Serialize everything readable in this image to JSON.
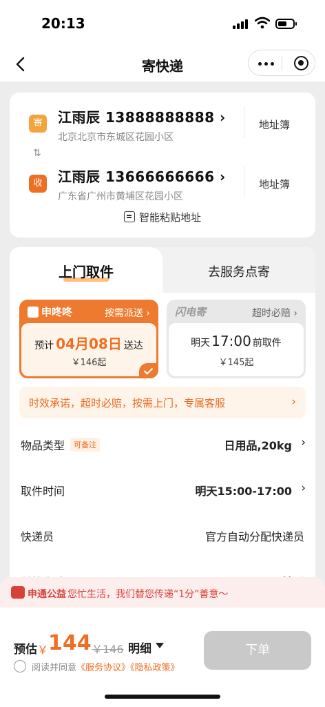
{
  "status_bar": {
    "time": "20:13"
  },
  "nav": {
    "title": "寄快递"
  },
  "sender": {
    "badge": "寄",
    "name_phone": "江雨辰  13888888888",
    "address": "北京北京市东城区花园小区",
    "address_book": "地址簿"
  },
  "receiver": {
    "badge": "收",
    "name_phone": "江雨辰  13666666666",
    "address": "广东省广州市黄埔区花园小区",
    "address_book": "地址簿"
  },
  "smart_paste": "智能粘贴地址",
  "tabs": [
    {
      "label": "上门取件",
      "active": true
    },
    {
      "label": "去服务点寄",
      "active": false
    }
  ],
  "services": [
    {
      "brand": "申咚咚",
      "tag": "按需派送",
      "prefix": "预计",
      "highlight": "04月08日",
      "suffix": "送达",
      "price": "￥146起",
      "selected": true
    },
    {
      "brand": "闪电寄",
      "tag": "超时必赔",
      "prefix": "明天",
      "highlight": "17:00",
      "suffix": "前取件",
      "price": "￥145起",
      "selected": false
    }
  ],
  "promise": "时效承诺，超时必赔，按需上门，专属客服",
  "rows": {
    "item_type": {
      "label": "物品类型",
      "tag": "可备注",
      "value": "日用品,20kg"
    },
    "pickup_time": {
      "label": "取件时间",
      "value": "明天15:00-17:00"
    },
    "courier": {
      "label": "快递员",
      "value": "官方自动分配快递员"
    },
    "payment": {
      "label": "付款方式",
      "value": "现付"
    }
  },
  "charity": {
    "brand": "申通公益",
    "text": "您忙生活，我们替您传递“1分”善意～"
  },
  "footer": {
    "estimate_label": "预估",
    "currency": "￥",
    "amount": "144",
    "original": "￥146",
    "detail": "明细",
    "agree_prefix": "阅读并同意",
    "service_agreement": "《服务协议》",
    "privacy_policy": "《隐私政策》",
    "submit": "下单"
  },
  "colors": {
    "accent": "#ee7a30",
    "accent_text": "#ee6f23",
    "charity_red": "#d8413a",
    "disabled_button": "#c9c9c9"
  }
}
